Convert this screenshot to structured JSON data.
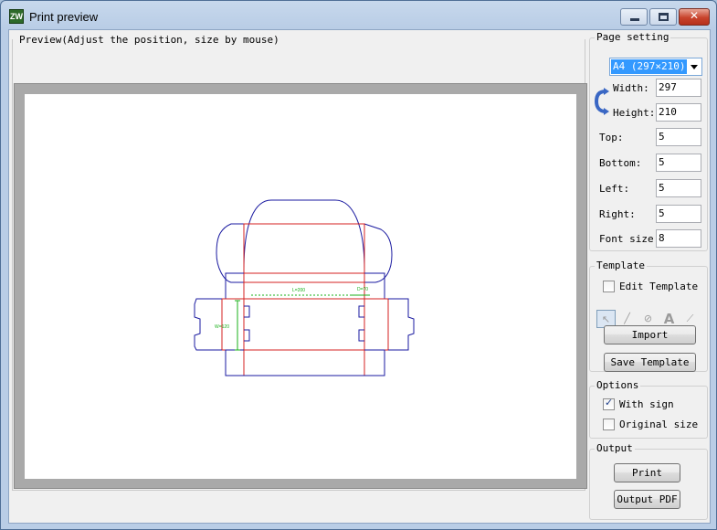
{
  "window": {
    "title": "Print preview",
    "app_icon_text": "ZW"
  },
  "preview": {
    "label": "Preview(Adjust the position, size by mouse)",
    "drawing_labels": {
      "length": "L=200",
      "depth": "D=70",
      "width": "W=120"
    }
  },
  "page_setting": {
    "title": "Page setting",
    "paper_size": "A4 (297×210)",
    "width_label": "Width:",
    "width_value": "297",
    "height_label": "Height:",
    "height_value": "210",
    "top_label": "Top:",
    "top_value": "5",
    "bottom_label": "Bottom:",
    "bottom_value": "5",
    "left_label": "Left:",
    "left_value": "5",
    "right_label": "Right:",
    "right_value": "5",
    "font_size_label": "Font size:",
    "font_size_value": "8"
  },
  "template": {
    "title": "Template",
    "edit_label": "Edit Template",
    "edit_checked": false,
    "tools": [
      "select-arrow-icon",
      "line-icon",
      "circle-icon",
      "text-icon",
      "pen-icon"
    ],
    "import_label": "Import",
    "save_label": "Save Template"
  },
  "options": {
    "title": "Options",
    "with_sign_label": "With sign",
    "with_sign_checked": true,
    "original_size_label": "Original size",
    "original_size_checked": false
  },
  "output": {
    "title": "Output",
    "print_label": "Print",
    "pdf_label": "Output PDF"
  },
  "colors": {
    "cut_line": "#1a1aa0",
    "fold_line": "#d42020",
    "dimension": "#19b019",
    "selection": "#3399ff"
  }
}
